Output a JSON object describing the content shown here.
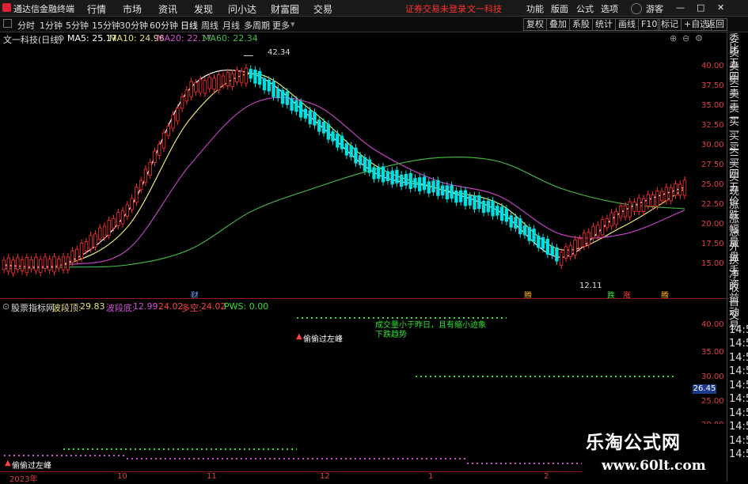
{
  "menubar": {
    "app_title": "通达信金融终端",
    "menus": [
      "行情",
      "市场",
      "资讯",
      "发现",
      "问小达",
      "财富圈",
      "交易"
    ],
    "notice": "证券交易未登录",
    "stock_link": "文一科技",
    "right_items": [
      "功能",
      "版面",
      "公式",
      "选项",
      "游客"
    ],
    "window_controls": [
      "—",
      "□",
      "✕"
    ]
  },
  "periodbar": {
    "periods": [
      "分时",
      "1分钟",
      "5分钟",
      "15分钟",
      "30分钟",
      "60分钟",
      "日线",
      "周线",
      "月线",
      "多周期",
      "更多"
    ],
    "active": "日线",
    "tools": [
      "复权",
      "叠加",
      "系股",
      "统计",
      "画线",
      "F10",
      "标记",
      "+自选",
      "返回"
    ]
  },
  "chart_title": {
    "stock": "文一科技(日线)",
    "ma5": "MA5: 25.17",
    "ma10": "MA10: 24.96",
    "ma20": "MA20: 22.17",
    "ma60": "MA60: 22.34"
  },
  "colors": {
    "ma5": "#ffffff",
    "ma10": "#e8e070",
    "ma20": "#c040c0",
    "ma60": "#40b040",
    "up": "#ff3030",
    "down": "#00e0e0"
  },
  "side_panel": {
    "items": [
      "委比",
      "卖五",
      "卖四",
      "卖三",
      "卖二",
      "卖一",
      "买一",
      "买二",
      "买三",
      "买四",
      "买五",
      "现价",
      "涨跌",
      "涨幅",
      "总量",
      "外盘",
      "换手",
      "净资",
      "收益",
      "自动",
      "交易",
      "14:5",
      "14:5",
      "14:5",
      "14:5",
      "14:5",
      "14:5",
      "14:5",
      "14:5",
      "14:5",
      "14:5"
    ]
  },
  "price_axis": [
    "40.00",
    "37.50",
    "35.00",
    "32.50",
    "30.00",
    "27.50",
    "25.00",
    "22.50",
    "20.00",
    "17.50",
    "15.00"
  ],
  "indicator_axis": [
    "40.00",
    "35.00",
    "30.00",
    "25.00",
    "20.00"
  ],
  "annotations": {
    "high": "42.34",
    "low": "12.11",
    "cai": "财",
    "teng1": "腾",
    "die": "跌",
    "zhang": "涨",
    "teng2": "腾"
  },
  "indicator": {
    "name": "股票指标网",
    "bdz_label": "波段顶:",
    "bdz_value": "29.83",
    "bdd_label": "波段底:",
    "bdd_value": "12.99",
    "v1": "24.02",
    "dk_label": "多空:",
    "dk_value": "24.02",
    "pws": "PWS: 0.00",
    "note1": "偷偷过左峰",
    "note2": "下跌趋势",
    "note3": "成交量小于昨日，且有缩小迹象",
    "note4": "偷偷过左峰",
    "current": "26.45"
  },
  "x_axis": [
    "2023年",
    "10",
    "11",
    "12",
    "1",
    "2"
  ],
  "watermark": {
    "title": "乐淘公式网",
    "url": "www.60lt.com"
  },
  "chart_data": {
    "type": "line",
    "title": "文一科技(日线)",
    "xlabel": "",
    "ylabel": "",
    "x": [
      "2023年",
      "10",
      "11",
      "12",
      "1",
      "2"
    ],
    "ylim": [
      12,
      43
    ],
    "series": [
      {
        "name": "MA5",
        "values": [
          15.0,
          15.2,
          22,
          38,
          40,
          34,
          27,
          25,
          22,
          16,
          22,
          25.17
        ]
      },
      {
        "name": "MA10",
        "values": [
          15.0,
          15.1,
          20,
          34,
          40,
          35,
          28,
          25,
          23,
          17,
          20,
          24.96
        ]
      },
      {
        "name": "MA20",
        "values": [
          14.8,
          15.0,
          17,
          28,
          36,
          36,
          30,
          26,
          24,
          19,
          19,
          22.17
        ]
      },
      {
        "name": "MA60",
        "values": [
          14.5,
          14.7,
          15,
          17,
          22,
          25,
          27.5,
          29,
          28.5,
          25,
          23,
          22.34
        ]
      }
    ],
    "high": 42.34,
    "low": 12.11
  }
}
